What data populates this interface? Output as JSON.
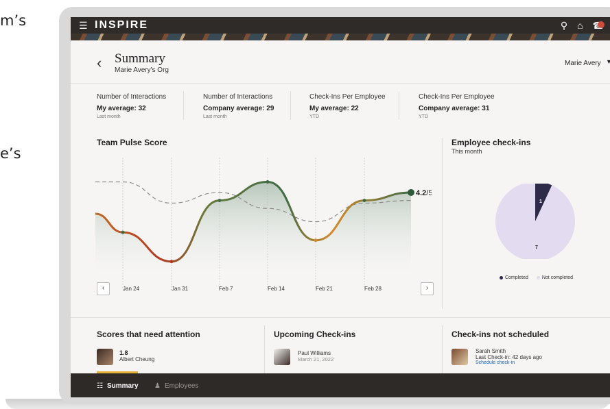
{
  "side_text": [
    "m’s",
    "e’s"
  ],
  "app": {
    "brand": "INSPIRE"
  },
  "header": {
    "title": "Summary",
    "subtitle": "Marie Avery's Org",
    "user": "Marie Avery"
  },
  "metrics": [
    {
      "label": "Number of Interactions",
      "value": "My average: 32",
      "period": "Last month"
    },
    {
      "label": "Number of Interactions",
      "value": "Company average: 29",
      "period": "Last month"
    },
    {
      "label": "Check-Ins Per Employee",
      "value": "My average: 22",
      "period": "YTD"
    },
    {
      "label": "Check-Ins Per Employee",
      "value": "Company average: 31",
      "period": "YTD"
    }
  ],
  "pulse": {
    "title": "Team Pulse Score",
    "current_value": "4.2",
    "unit": "/5"
  },
  "chart_data": {
    "type": "line",
    "title": "Team Pulse Score",
    "x": [
      "Jan 24",
      "Jan 31",
      "Feb 7",
      "Feb 14",
      "Feb 21",
      "Feb 28"
    ],
    "series": [
      {
        "values": [
          2.7,
          1.6,
          3.9,
          4.6,
          2.4,
          3.9
        ]
      },
      {
        "values": [
          4.6,
          3.8,
          4.2,
          3.6,
          3.1,
          3.8
        ]
      }
    ],
    "end_value": 4.2,
    "ylim": [
      1,
      5
    ],
    "grid": true
  },
  "checkins": {
    "title": "Employee check-ins",
    "subtitle": "This month",
    "completed": 1,
    "not_completed": 7,
    "legend_completed": "Completed",
    "legend_not_completed": "Not completed",
    "colors": {
      "completed": "#2e2a4a",
      "not_completed": "#e3dcf0"
    }
  },
  "cards": {
    "attention": {
      "title": "Scores that need attention",
      "score": "1.8",
      "name": "Albert Cheung"
    },
    "upcoming": {
      "title": "Upcoming Check-ins",
      "name": "Paul Williams",
      "date": "March 21, 2022"
    },
    "not_scheduled": {
      "title": "Check-ins not scheduled",
      "name": "Sarah Smith",
      "last": "Last Check-in: 42 days ago",
      "action": "Schedule check-in"
    }
  },
  "bottom_nav": {
    "summary": "Summary",
    "employees": "Employees"
  },
  "icons": [
    "menu-icon",
    "search-icon",
    "home-icon",
    "notification-icon",
    "back-icon",
    "chevron-left-icon",
    "chevron-right-icon",
    "summary-icon",
    "people-icon"
  ]
}
